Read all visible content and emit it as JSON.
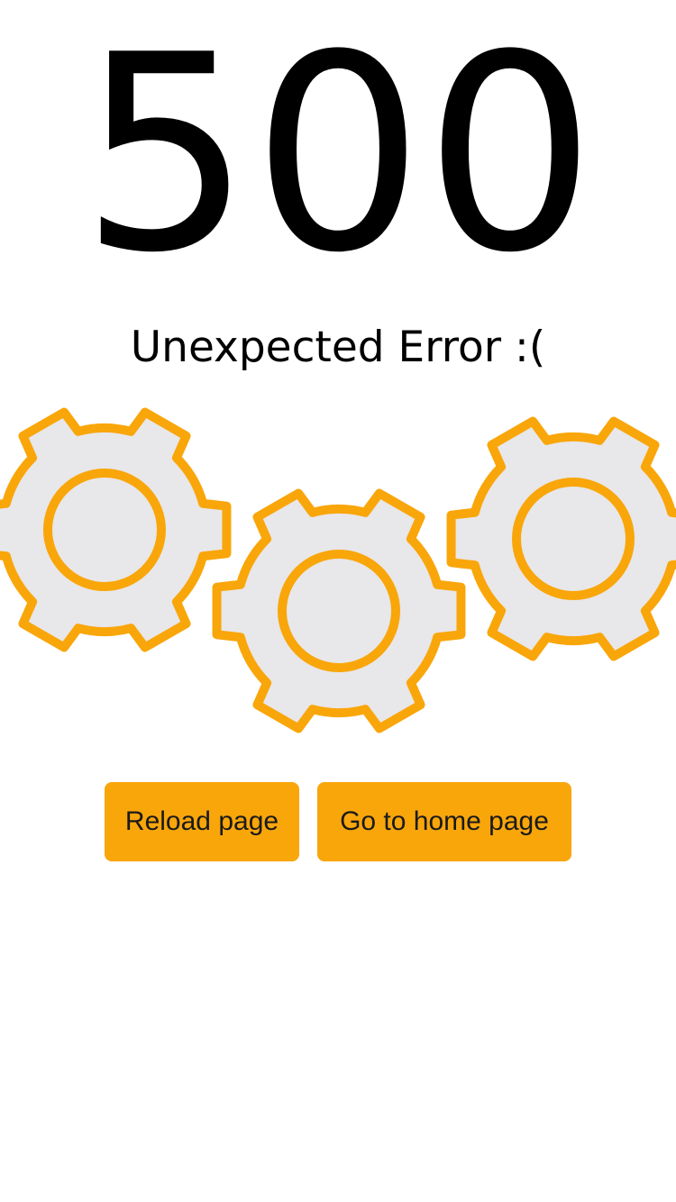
{
  "error": {
    "code": "500",
    "message": "Unexpected Error :("
  },
  "illustration": {
    "gear_count": 3,
    "icon": "gears-icon",
    "colors": {
      "outline": "#f9a60a",
      "fill": "#e8e7e9"
    }
  },
  "actions": {
    "reload_label": "Reload page",
    "home_label": "Go to home page",
    "button_color": "#f9a60a"
  }
}
